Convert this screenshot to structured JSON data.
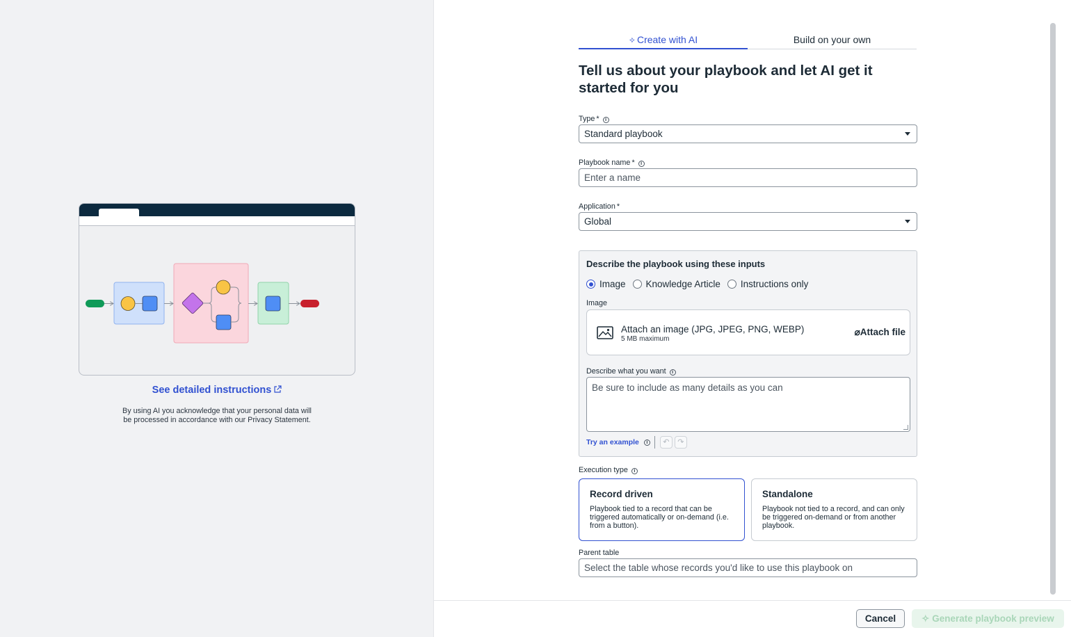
{
  "left_panel": {
    "instructions_link": "See detailed instructions",
    "privacy_text": "By using AI you acknowledge that your personal data will be processed in accordance with our Privacy Statement."
  },
  "tabs": [
    {
      "label": "Create with AI",
      "icon": "sparkle-icon",
      "active": true
    },
    {
      "label": "Build on your own",
      "active": false
    }
  ],
  "heading": "Tell us about your playbook and let AI get it started for you",
  "form": {
    "type": {
      "label": "Type",
      "required_mark": "*",
      "value": "Standard playbook"
    },
    "name": {
      "label": "Playbook name",
      "required_mark": "*",
      "value": "",
      "placeholder": "Enter a name"
    },
    "application": {
      "label": "Application",
      "required_mark": "*",
      "value": "Global"
    }
  },
  "describe": {
    "title": "Describe the playbook using these inputs",
    "options": [
      "Image",
      "Knowledge Article",
      "Instructions only"
    ],
    "selected_option": "Image",
    "image_label": "Image",
    "attach_title": "Attach an image (JPG, JPEG, PNG, WEBP)",
    "attach_sub": "5 MB maximum",
    "attach_button": "Attach file",
    "want_label": "Describe what you want",
    "want_placeholder": "Be sure to include as many details as you can",
    "try_example": "Try an example"
  },
  "execution": {
    "label": "Execution type",
    "cards": [
      {
        "title": "Record driven",
        "desc": "Playbook tied to a record that can be triggered automatically or on-demand (i.e. from a button).",
        "selected": true
      },
      {
        "title": "Standalone",
        "desc": "Playbook not tied to a record, and can only be triggered on-demand or from another playbook.",
        "selected": false
      }
    ]
  },
  "parent_table": {
    "label": "Parent table",
    "placeholder": "Select the table whose records you'd like to use this playbook on"
  },
  "footer": {
    "cancel": "Cancel",
    "generate": "Generate playbook preview"
  },
  "colors": {
    "accent": "#3151d1",
    "header_dark": "#0c2a3f",
    "start_green": "#0f9a58",
    "end_red": "#c8202d",
    "generate_disabled_bg": "#e8f5ec"
  }
}
